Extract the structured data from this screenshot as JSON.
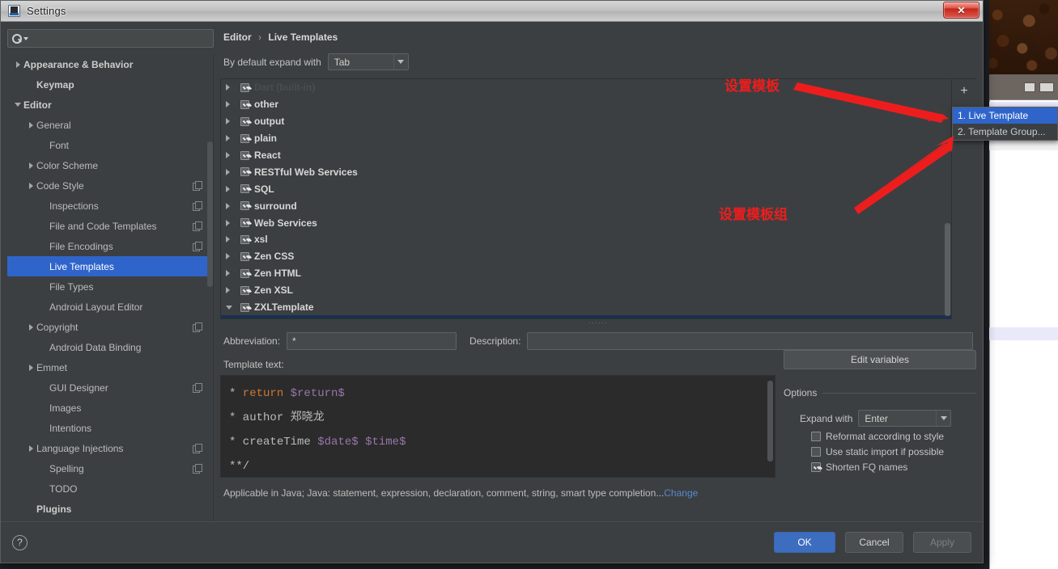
{
  "window": {
    "title": "Settings",
    "app_icon": "intellij-idea-icon",
    "close_label": "✕"
  },
  "search": {
    "placeholder": "",
    "value": "",
    "icon": "search-icon"
  },
  "sidebar": {
    "items": [
      {
        "label": "Appearance & Behavior",
        "twisty": "right",
        "indent": 0,
        "bold": true,
        "copy": false,
        "selected": false
      },
      {
        "label": "Keymap",
        "twisty": "none",
        "indent": 1,
        "bold": true,
        "copy": false,
        "selected": false
      },
      {
        "label": "Editor",
        "twisty": "down",
        "indent": 0,
        "bold": true,
        "copy": false,
        "selected": false
      },
      {
        "label": "General",
        "twisty": "right",
        "indent": 1,
        "bold": false,
        "copy": false,
        "selected": false
      },
      {
        "label": "Font",
        "twisty": "none",
        "indent": 2,
        "bold": false,
        "copy": false,
        "selected": false
      },
      {
        "label": "Color Scheme",
        "twisty": "right",
        "indent": 1,
        "bold": false,
        "copy": false,
        "selected": false
      },
      {
        "label": "Code Style",
        "twisty": "right",
        "indent": 1,
        "bold": false,
        "copy": true,
        "selected": false
      },
      {
        "label": "Inspections",
        "twisty": "none",
        "indent": 2,
        "bold": false,
        "copy": true,
        "selected": false
      },
      {
        "label": "File and Code Templates",
        "twisty": "none",
        "indent": 2,
        "bold": false,
        "copy": true,
        "selected": false
      },
      {
        "label": "File Encodings",
        "twisty": "none",
        "indent": 2,
        "bold": false,
        "copy": true,
        "selected": false
      },
      {
        "label": "Live Templates",
        "twisty": "none",
        "indent": 2,
        "bold": false,
        "copy": false,
        "selected": true
      },
      {
        "label": "File Types",
        "twisty": "none",
        "indent": 2,
        "bold": false,
        "copy": false,
        "selected": false
      },
      {
        "label": "Android Layout Editor",
        "twisty": "none",
        "indent": 2,
        "bold": false,
        "copy": false,
        "selected": false
      },
      {
        "label": "Copyright",
        "twisty": "right",
        "indent": 1,
        "bold": false,
        "copy": true,
        "selected": false
      },
      {
        "label": "Android Data Binding",
        "twisty": "none",
        "indent": 2,
        "bold": false,
        "copy": false,
        "selected": false
      },
      {
        "label": "Emmet",
        "twisty": "right",
        "indent": 1,
        "bold": false,
        "copy": false,
        "selected": false
      },
      {
        "label": "GUI Designer",
        "twisty": "none",
        "indent": 2,
        "bold": false,
        "copy": true,
        "selected": false
      },
      {
        "label": "Images",
        "twisty": "none",
        "indent": 2,
        "bold": false,
        "copy": false,
        "selected": false
      },
      {
        "label": "Intentions",
        "twisty": "none",
        "indent": 2,
        "bold": false,
        "copy": false,
        "selected": false
      },
      {
        "label": "Language Injections",
        "twisty": "right",
        "indent": 1,
        "bold": false,
        "copy": true,
        "selected": false
      },
      {
        "label": "Spelling",
        "twisty": "none",
        "indent": 2,
        "bold": false,
        "copy": true,
        "selected": false
      },
      {
        "label": "TODO",
        "twisty": "none",
        "indent": 2,
        "bold": false,
        "copy": false,
        "selected": false
      },
      {
        "label": "Plugins",
        "twisty": "none",
        "indent": 1,
        "bold": true,
        "copy": false,
        "selected": false
      }
    ]
  },
  "breadcrumb": {
    "root": "Editor",
    "separator": "›",
    "leaf": "Live Templates"
  },
  "expand_default": {
    "label": "By default expand with",
    "value": "Tab"
  },
  "templates": {
    "rows": [
      {
        "label": "Dart (built-in)",
        "twisty": "right",
        "checked": true,
        "child": false,
        "selected": false,
        "ghost": true
      },
      {
        "label": "other",
        "twisty": "right",
        "checked": true,
        "child": false,
        "selected": false,
        "ghost": false
      },
      {
        "label": "output",
        "twisty": "right",
        "checked": true,
        "child": false,
        "selected": false,
        "ghost": false
      },
      {
        "label": "plain",
        "twisty": "right",
        "checked": true,
        "child": false,
        "selected": false,
        "ghost": false
      },
      {
        "label": "React",
        "twisty": "right",
        "checked": true,
        "child": false,
        "selected": false,
        "ghost": false
      },
      {
        "label": "RESTful Web Services",
        "twisty": "right",
        "checked": true,
        "child": false,
        "selected": false,
        "ghost": false
      },
      {
        "label": "SQL",
        "twisty": "right",
        "checked": true,
        "child": false,
        "selected": false,
        "ghost": false
      },
      {
        "label": "surround",
        "twisty": "right",
        "checked": true,
        "child": false,
        "selected": false,
        "ghost": false
      },
      {
        "label": "Web Services",
        "twisty": "right",
        "checked": true,
        "child": false,
        "selected": false,
        "ghost": false
      },
      {
        "label": "xsl",
        "twisty": "right",
        "checked": true,
        "child": false,
        "selected": false,
        "ghost": false
      },
      {
        "label": "Zen CSS",
        "twisty": "right",
        "checked": true,
        "child": false,
        "selected": false,
        "ghost": false
      },
      {
        "label": "Zen HTML",
        "twisty": "right",
        "checked": true,
        "child": false,
        "selected": false,
        "ghost": false
      },
      {
        "label": "Zen XSL",
        "twisty": "right",
        "checked": true,
        "child": false,
        "selected": false,
        "ghost": false
      },
      {
        "label": "ZXLTemplate",
        "twisty": "down",
        "checked": true,
        "child": false,
        "selected": false,
        "ghost": false
      },
      {
        "label": "*",
        "twisty": "none",
        "checked": true,
        "child": true,
        "selected": true,
        "ghost": false
      }
    ],
    "tools": {
      "add": "+",
      "remove": "−",
      "revert": "↺"
    }
  },
  "add_menu": {
    "items": [
      {
        "label": "1. Live Template",
        "selected": true
      },
      {
        "label": "2. Template Group...",
        "selected": false
      }
    ]
  },
  "form": {
    "abbreviation_label": "Abbreviation:",
    "abbreviation_value": "*",
    "description_label": "Description:",
    "description_value": "",
    "template_text_label": "Template text:",
    "template_lines": [
      {
        "prefix": "*",
        "keyword": " return ",
        "variable": "$return$",
        "extra": ""
      },
      {
        "prefix": "*",
        "keyword": "",
        "variable": "",
        "extra": " author 郑晓龙"
      },
      {
        "prefix": "*",
        "keyword": "",
        "variable": "",
        "extra": " createTime $date$ $time$"
      },
      {
        "prefix": "**/",
        "keyword": "",
        "variable": "",
        "extra": ""
      }
    ]
  },
  "options": {
    "edit_variables_label": "Edit variables",
    "title": "Options",
    "expand_with_label": "Expand with",
    "expand_with_value": "Enter",
    "checkboxes": [
      {
        "label": "Reformat according to style",
        "checked": false
      },
      {
        "label": "Use static import if possible",
        "checked": false
      },
      {
        "label": "Shorten FQ names",
        "checked": true
      }
    ]
  },
  "applicable": {
    "text": "Applicable in Java; Java: statement, expression, declaration, comment, string, smart type completion...",
    "change_link": "Change"
  },
  "footer": {
    "help": "?",
    "ok": "OK",
    "cancel": "Cancel",
    "apply": "Apply"
  },
  "annotations": [
    {
      "text": "设置模板",
      "color": "#ee1d1d"
    },
    {
      "text": "设置模板组",
      "color": "#ee1d1d"
    }
  ],
  "colors": {
    "accent_blue": "#2f65ca",
    "panel_bg": "#3c3f41",
    "editor_bg": "#2b2b2b",
    "annotation_red": "#ee1d1d",
    "ok_button": "#3d6dbf"
  }
}
